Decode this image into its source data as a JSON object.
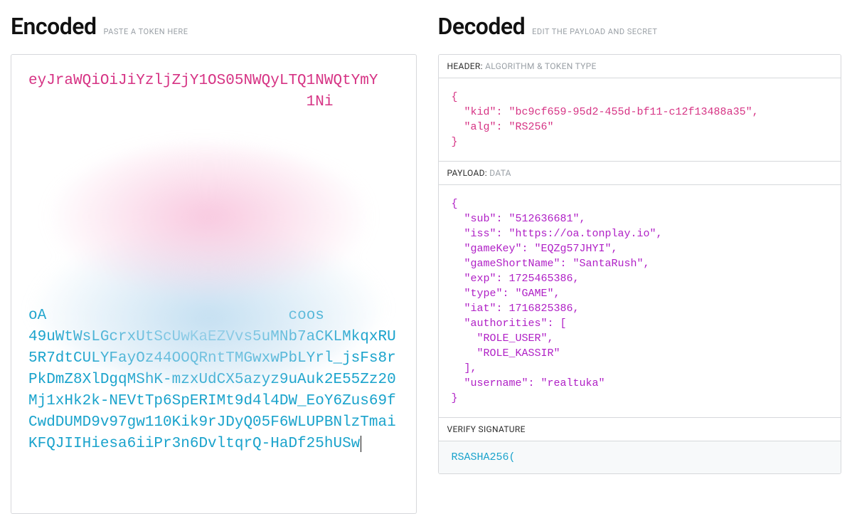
{
  "encoded": {
    "title": "Encoded",
    "subtitle": "PASTE A TOKEN HERE",
    "token_header_visible": "eyJraWQiOiJiYzljZjY1OS05NWQyLTQ1NWQtYmY",
    "token_header_tail": "1Ni",
    "token_sig_visible_pre": "oA",
    "token_sig_visible_mid": "coos",
    "token_sig_visible": "49uWtWsLGcrxUtScUwKaEZVvs5uMNb7aCKLMkqxRU5R7dtCULYFayOz44OOQRntTMGwxwPbLYrl_jsFs8rPkDmZ8XlDgqMShK-mzxUdCX5azyz9uAuk2E55Zz20Mj1xHk2k-NEVtTp6SpERIMt9d4l4DW_EoY6Zus69fCwdDUMD9v97gw110Kik9rJDyQ05F6WLUPBNlzTmaiKFQJIIHiesa6iiPr3n6DvltqrQ-HaDf25hUSw"
  },
  "decoded": {
    "title": "Decoded",
    "subtitle": "EDIT THE PAYLOAD AND SECRET",
    "header_section": {
      "label": "HEADER:",
      "sublabel": "ALGORITHM & TOKEN TYPE",
      "json": "{\n  \"kid\": \"bc9cf659-95d2-455d-bf11-c12f13488a35\",\n  \"alg\": \"RS256\"\n}"
    },
    "payload_section": {
      "label": "PAYLOAD:",
      "sublabel": "DATA",
      "json": "{\n  \"sub\": \"512636681\",\n  \"iss\": \"https://oa.tonplay.io\",\n  \"gameKey\": \"EQZg57JHYI\",\n  \"gameShortName\": \"SantaRush\",\n  \"exp\": 1725465386,\n  \"type\": \"GAME\",\n  \"iat\": 1716825386,\n  \"authorities\": [\n    \"ROLE_USER\",\n    \"ROLE_KASSIR\"\n  ],\n  \"username\": \"realtuka\"\n}"
    },
    "verify_section": {
      "label": "VERIFY SIGNATURE",
      "body": "RSASHA256("
    }
  }
}
